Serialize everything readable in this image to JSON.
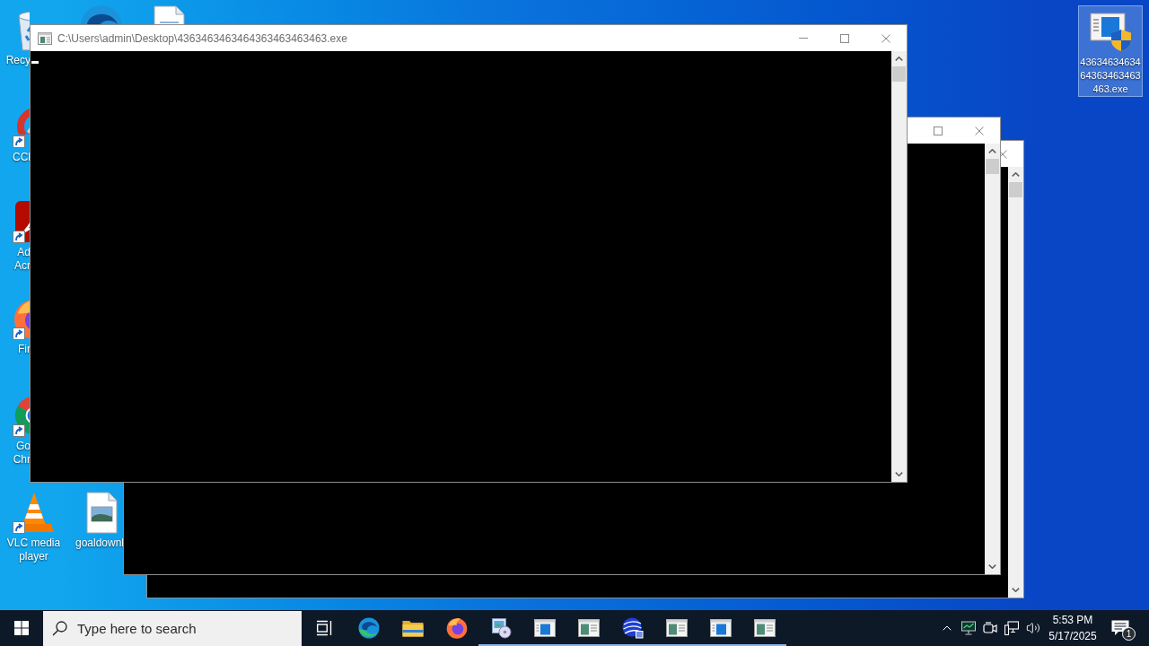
{
  "desktop_icons": [
    {
      "kind": "recycle-bin",
      "label": [
        "Recy"
      ],
      "shortcut": false,
      "selected": false
    },
    {
      "kind": "edge",
      "selected": false
    },
    {
      "kind": "document",
      "selected": false
    },
    {
      "kind": "exe",
      "label": [
        "4363463463464363463463463.exe"
      ],
      "shortcut": false,
      "selected": true
    },
    {
      "kind": "ccleaner",
      "label": [
        "CCl"
      ],
      "shortcut": true,
      "selected": false
    },
    {
      "kind": "acrobat",
      "label": [
        "Ad",
        "Acr"
      ],
      "shortcut": true,
      "selected": false
    },
    {
      "kind": "firefox",
      "label": [
        "Fir"
      ],
      "shortcut": true,
      "selected": false
    },
    {
      "kind": "chrome",
      "label": [
        "Go",
        "Chr"
      ],
      "shortcut": true,
      "selected": false
    },
    {
      "kind": "vlc",
      "label": [
        "VLC media player"
      ],
      "shortcut": true,
      "selected": false
    },
    {
      "kind": "image-file",
      "label": [
        "goaldownl"
      ],
      "shortcut": false,
      "selected": false
    }
  ],
  "windows": [
    {
      "kind": "console",
      "title": "C:\\Users\\admin\\Desktop\\4363463463464363463463463.exe",
      "active": false,
      "cursor": true
    },
    {
      "kind": "console",
      "active": false
    },
    {
      "kind": "console",
      "active": false
    }
  ],
  "taskbar": {
    "search": {
      "placeholder": "Type here to search"
    },
    "apps": [
      {
        "kind": "task-view",
        "running": false
      },
      {
        "kind": "edge",
        "running": false
      },
      {
        "kind": "explorer",
        "running": false
      },
      {
        "kind": "firefox",
        "running": false
      },
      {
        "kind": "installer",
        "running": true
      },
      {
        "kind": "window-blue",
        "running": true
      },
      {
        "kind": "window-green",
        "running": true
      },
      {
        "kind": "globe",
        "running": true
      },
      {
        "kind": "window-green",
        "running": true
      },
      {
        "kind": "window-blue",
        "running": true
      },
      {
        "kind": "window-green",
        "running": true
      }
    ],
    "clock": {
      "time": "5:53 PM",
      "date": "5/17/2025"
    },
    "notifications": {
      "count": "1"
    }
  }
}
